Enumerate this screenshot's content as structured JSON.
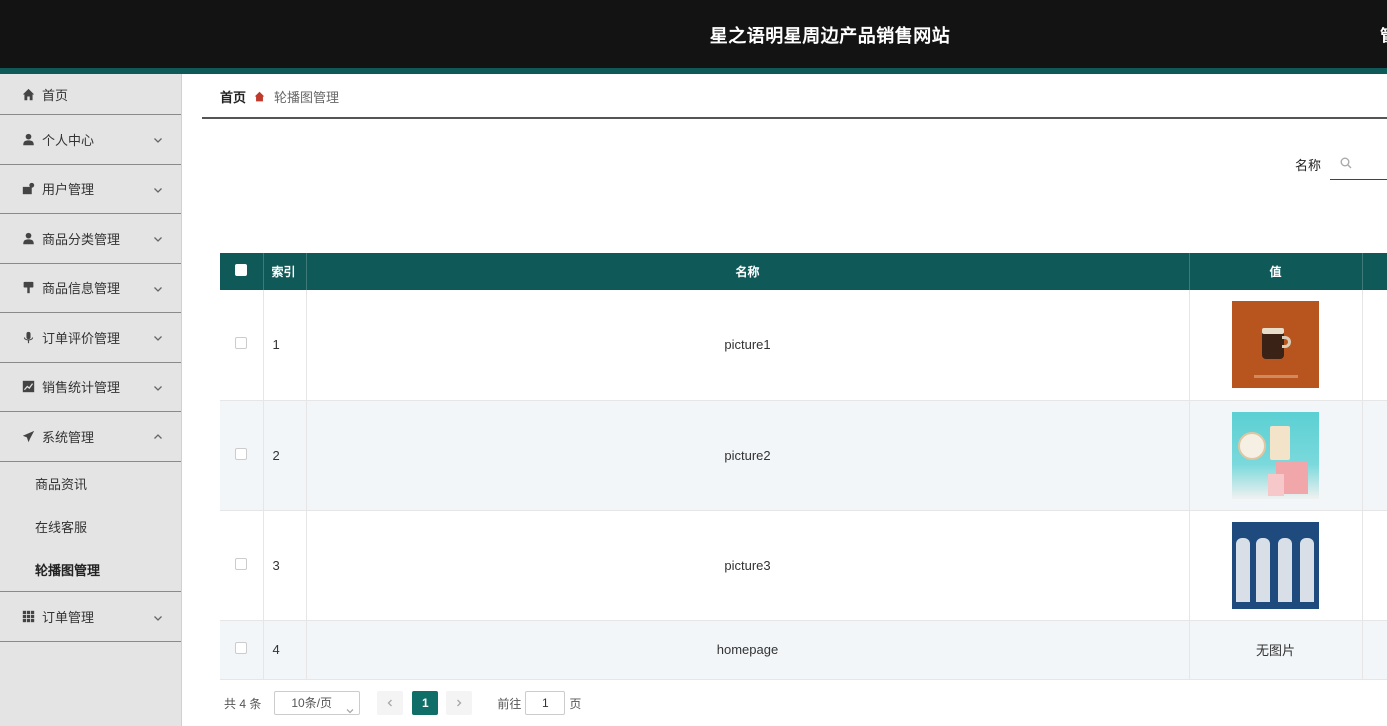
{
  "app": {
    "title": "星之语明星周边产品销售网站",
    "right_clip": "管"
  },
  "sidebar": {
    "items": [
      {
        "label": "首页",
        "icon": "home-icon"
      },
      {
        "label": "个人中心",
        "icon": "user-icon"
      },
      {
        "label": "用户管理",
        "icon": "users-icon"
      },
      {
        "label": "商品分类管理",
        "icon": "user-icon"
      },
      {
        "label": "商品信息管理",
        "icon": "stamp-icon"
      },
      {
        "label": "订单评价管理",
        "icon": "microphone-icon"
      },
      {
        "label": "销售统计管理",
        "icon": "chart-icon"
      },
      {
        "label": "系统管理",
        "icon": "paper-plane-icon"
      },
      {
        "label": "订单管理",
        "icon": "grid-icon"
      }
    ],
    "system_sub": [
      {
        "label": "商品资讯"
      },
      {
        "label": "在线客服"
      },
      {
        "label": "轮播图管理",
        "active": true
      }
    ]
  },
  "breadcrumb": {
    "home": "首页",
    "current": "轮播图管理"
  },
  "search": {
    "label": "名称",
    "value": ""
  },
  "table": {
    "headers": {
      "index": "索引",
      "name": "名称",
      "value": "值"
    },
    "rows": [
      {
        "index": "1",
        "name": "picture1",
        "value": "image"
      },
      {
        "index": "2",
        "name": "picture2",
        "value": "image"
      },
      {
        "index": "3",
        "name": "picture3",
        "value": "image"
      },
      {
        "index": "4",
        "name": "homepage",
        "value": "无图片"
      }
    ]
  },
  "pagination": {
    "total": "共 4 条",
    "page_size": "10条/页",
    "current_page": "1",
    "goto_label": "前往",
    "goto_value": "1",
    "page_unit": "页"
  }
}
